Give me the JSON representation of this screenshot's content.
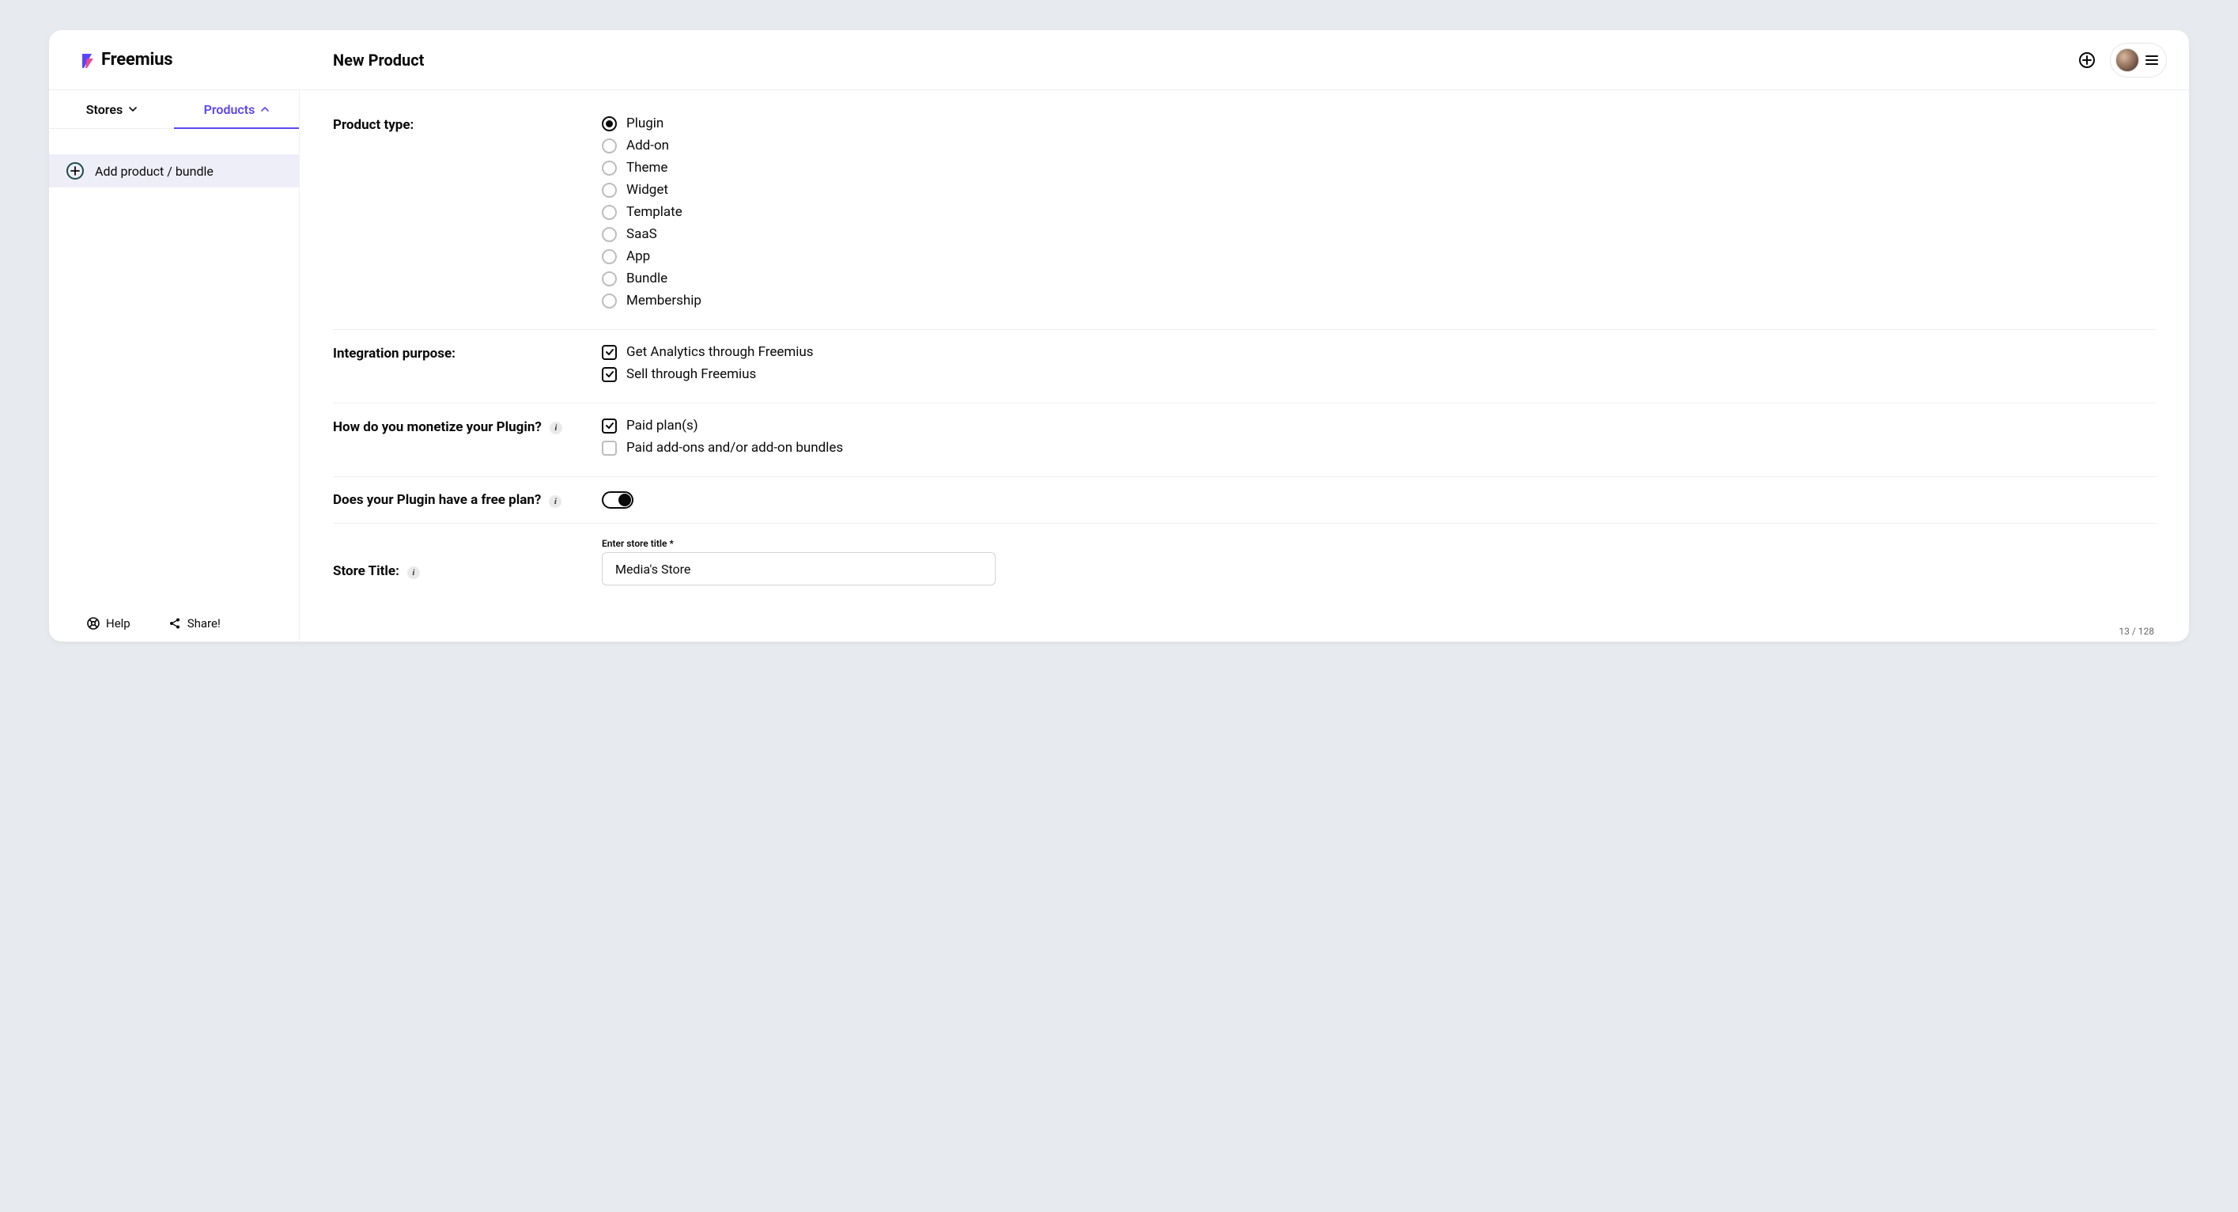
{
  "brand": {
    "name": "Freemius"
  },
  "header": {
    "page_title": "New Product"
  },
  "sidebar": {
    "tabs": {
      "stores": "Stores",
      "products": "Products"
    },
    "add_product_label": "Add product / bundle",
    "footer": {
      "help": "Help",
      "share": "Share!"
    }
  },
  "form": {
    "product_type": {
      "label": "Product type:",
      "options": {
        "plugin": "Plugin",
        "addon": "Add-on",
        "theme": "Theme",
        "widget": "Widget",
        "template": "Template",
        "saas": "SaaS",
        "app": "App",
        "bundle": "Bundle",
        "membership": "Membership"
      },
      "selected": "plugin"
    },
    "integration_purpose": {
      "label": "Integration purpose:",
      "options": {
        "analytics": "Get Analytics through Freemius",
        "sell": "Sell through Freemius"
      }
    },
    "monetize": {
      "label": "How do you monetize your Plugin?",
      "options": {
        "paid_plans": "Paid plan(s)",
        "paid_addons": "Paid add-ons and/or add-on bundles"
      }
    },
    "free_plan": {
      "label": "Does your Plugin have a free plan?"
    },
    "store_title": {
      "label": "Store Title:",
      "input_label": "Enter store title",
      "value": "Media's Store",
      "counter": "13 / 128"
    }
  }
}
